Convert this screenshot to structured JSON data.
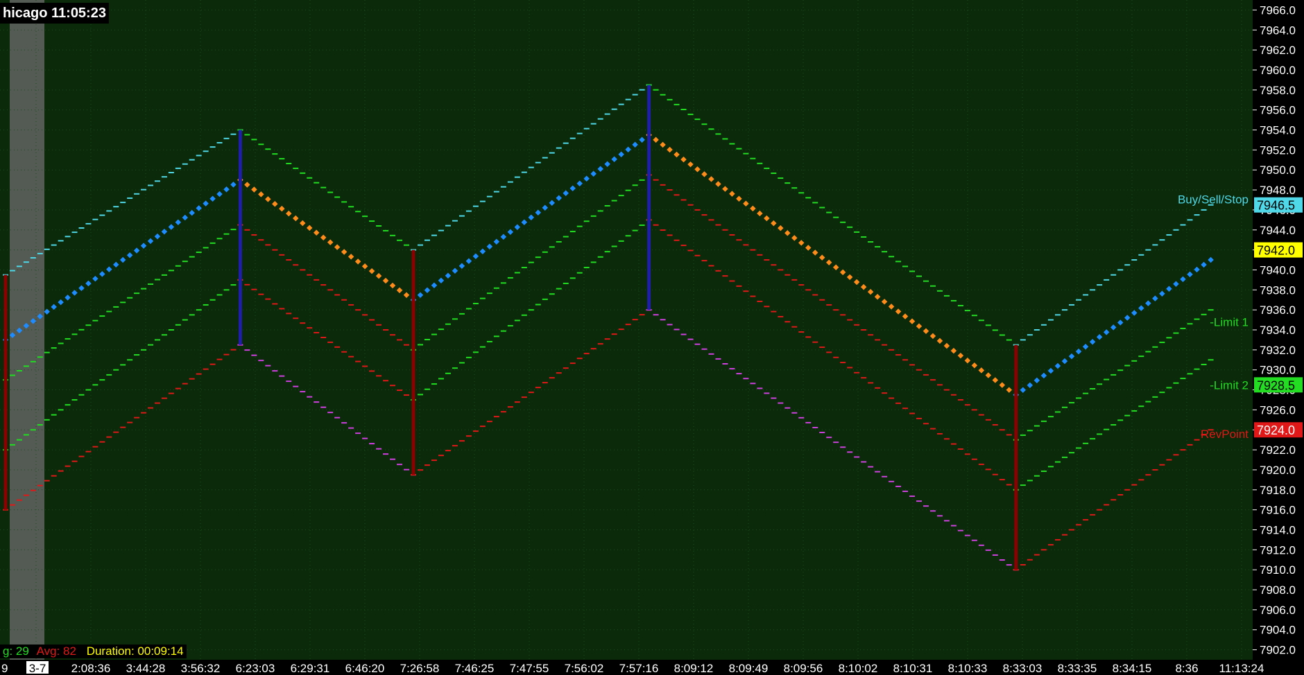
{
  "header": {
    "title": "hicago 11:05:23"
  },
  "stats": {
    "g_label": "g:",
    "g_value": "29",
    "avg_label": "Avg:",
    "avg_value": "82",
    "duration_label": "Duration:",
    "duration_value": "00:09:14"
  },
  "colors": {
    "background": "#0a2a0a",
    "grid": "#1f4d1f",
    "cyan": "#4fd8e8",
    "blue": "#1e8cff",
    "green": "#22dd22",
    "red": "#e01818",
    "orange": "#ff8c1a",
    "magenta": "#d040e0",
    "yellow": "#ffff00"
  },
  "chart_data": {
    "type": "line",
    "ylim": [
      7901,
      7967
    ],
    "y_ticks": [
      7902.0,
      7904.0,
      7906.0,
      7908.0,
      7910.0,
      7912.0,
      7914.0,
      7916.0,
      7918.0,
      7920.0,
      7922.0,
      7924.0,
      7926.0,
      7928.0,
      7930.0,
      7932.0,
      7934.0,
      7936.0,
      7938.0,
      7940.0,
      7942.0,
      7944.0,
      7946.0,
      7948.0,
      7950.0,
      7952.0,
      7954.0,
      7956.0,
      7958.0,
      7960.0,
      7962.0,
      7964.0,
      7966.0
    ],
    "x_tick_labels": [
      "3-7",
      "2:08:36",
      "3:44:28",
      "3:56:32",
      "6:23:03",
      "6:29:31",
      "6:46:20",
      "7:26:58",
      "7:46:25",
      "7:47:55",
      "7:56:02",
      "7:57:16",
      "8:09:12",
      "8:09:49",
      "8:09:56",
      "8:10:02",
      "8:10:31",
      "8:10:33",
      "8:33:03",
      "8:33:35",
      "8:34:15",
      "8:36",
      "11:13:24"
    ],
    "x_tick_partial_left": "9",
    "grid": true,
    "series": [
      {
        "key": "top",
        "color": "#4fd8e8",
        "alt_color": "#22dd22",
        "pivots": [
          [
            0,
            7939.5
          ],
          [
            282,
            7954
          ],
          [
            490,
            7942
          ],
          [
            773,
            7958.5
          ],
          [
            1214,
            7932.5
          ],
          [
            1448,
            7946.5
          ]
        ]
      },
      {
        "key": "blue",
        "color": "#1e8cff",
        "alt_color": "#ff8c1a",
        "pivots": [
          [
            0,
            7933
          ],
          [
            282,
            7949
          ],
          [
            490,
            7937
          ],
          [
            773,
            7953.5
          ],
          [
            1214,
            7927.5
          ],
          [
            1448,
            7941
          ]
        ]
      },
      {
        "key": "mid1",
        "color": "#22dd22",
        "alt_color": "#e01818",
        "pivots": [
          [
            0,
            7929
          ],
          [
            282,
            7944.5
          ],
          [
            490,
            7932
          ],
          [
            773,
            7949.5
          ],
          [
            1214,
            7923
          ],
          [
            1448,
            7936
          ]
        ]
      },
      {
        "key": "mid2",
        "color": "#22dd22",
        "alt_color": "#e01818",
        "pivots": [
          [
            0,
            7922
          ],
          [
            282,
            7939
          ],
          [
            490,
            7927
          ],
          [
            773,
            7945
          ],
          [
            1214,
            7918
          ],
          [
            1448,
            7931
          ]
        ]
      },
      {
        "key": "bottom",
        "color": "#e01818",
        "alt_color": "#d040e0",
        "pivots": [
          [
            0,
            7916
          ],
          [
            282,
            7932.5
          ],
          [
            490,
            7919.5
          ],
          [
            773,
            7936
          ],
          [
            1214,
            7910
          ],
          [
            1448,
            7924
          ]
        ]
      }
    ],
    "annotations": [
      {
        "label": "Buy/Sell/Stop",
        "color": "#4fd8e8",
        "value": 7946.5
      },
      {
        "label": "-Limit 1",
        "color": "#22dd22",
        "value": 7935.5
      },
      {
        "label": "-Limit 2",
        "color": "#22dd22",
        "value": 7928.5
      },
      {
        "label": "RevPoint",
        "color": "#e01818",
        "value": 7924.0
      }
    ],
    "price_badges": [
      {
        "text": "7946.5",
        "value": 7946.5,
        "bg": "#4fd8e8",
        "fg": "#000000"
      },
      {
        "text": "7942.0",
        "value": 7942.0,
        "bg": "#ffff00",
        "fg": "#000000"
      },
      {
        "text": "7928.5",
        "value": 7928.5,
        "bg": "#22dd22",
        "fg": "#000000"
      },
      {
        "text": "7924.0",
        "value": 7924.0,
        "bg": "#e01818",
        "fg": "#ffffff"
      }
    ]
  }
}
